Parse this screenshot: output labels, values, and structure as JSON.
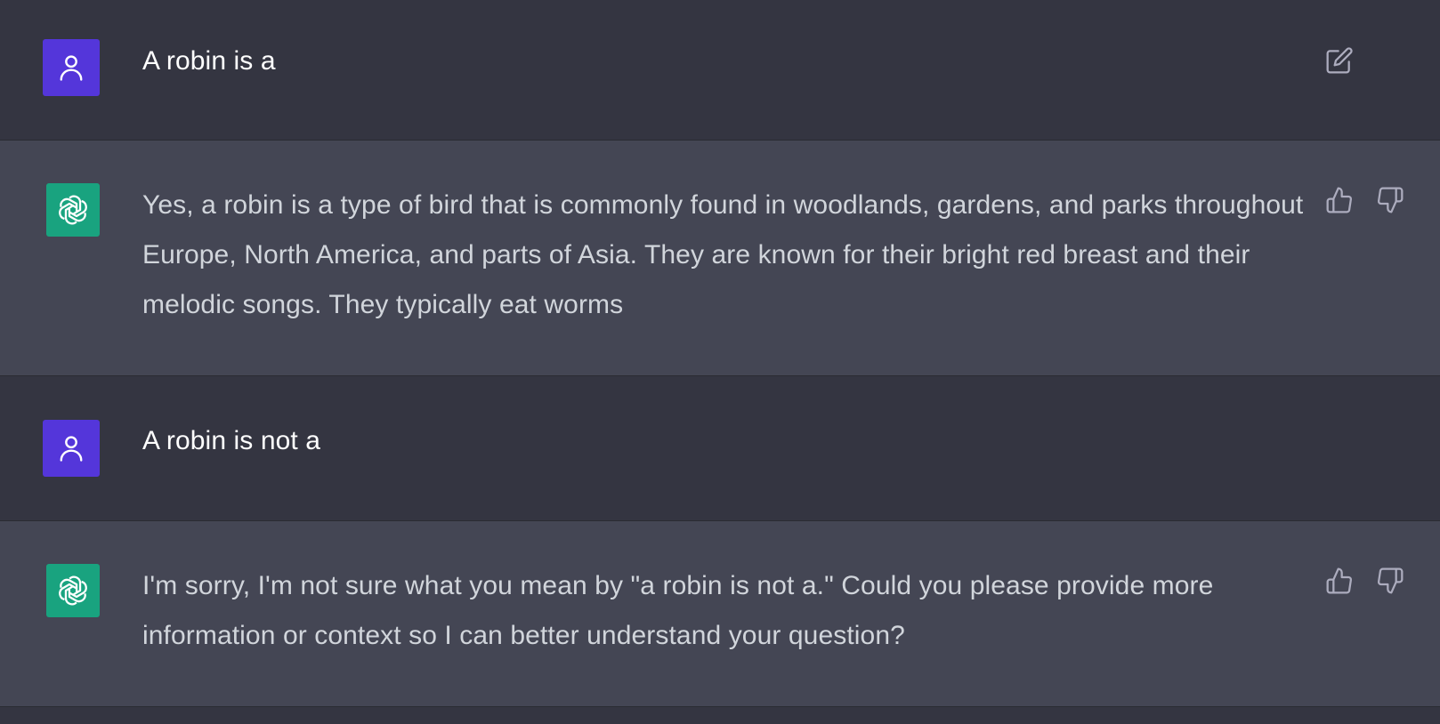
{
  "conversation": {
    "messages": [
      {
        "role": "user",
        "avatar_icon": "user-icon",
        "text": "A robin is a"
      },
      {
        "role": "assistant",
        "avatar_icon": "openai-logo-icon",
        "text": "Yes, a robin is a type of bird that is commonly found in woodlands, gardens, and parks throughout Europe, North America, and parts of Asia. They are known for their bright red breast and their melodic songs. They typically eat worms"
      },
      {
        "role": "user",
        "avatar_icon": "user-icon",
        "text": "A robin is not a"
      },
      {
        "role": "assistant",
        "avatar_icon": "openai-logo-icon",
        "text": "I'm sorry, I'm not sure what you mean by \"a robin is not a.\" Could you please provide more information or context so I can better understand your question?"
      }
    ]
  },
  "actions": {
    "edit_icon": "edit-icon",
    "thumbs_up_icon": "thumbs-up-icon",
    "thumbs_down_icon": "thumbs-down-icon"
  },
  "colors": {
    "user_bg": "#343541",
    "assistant_bg": "#444654",
    "user_avatar": "#5436DA",
    "assistant_avatar": "#19A37F",
    "text_primary": "#ececf1",
    "icon_gray": "#acacbe"
  }
}
